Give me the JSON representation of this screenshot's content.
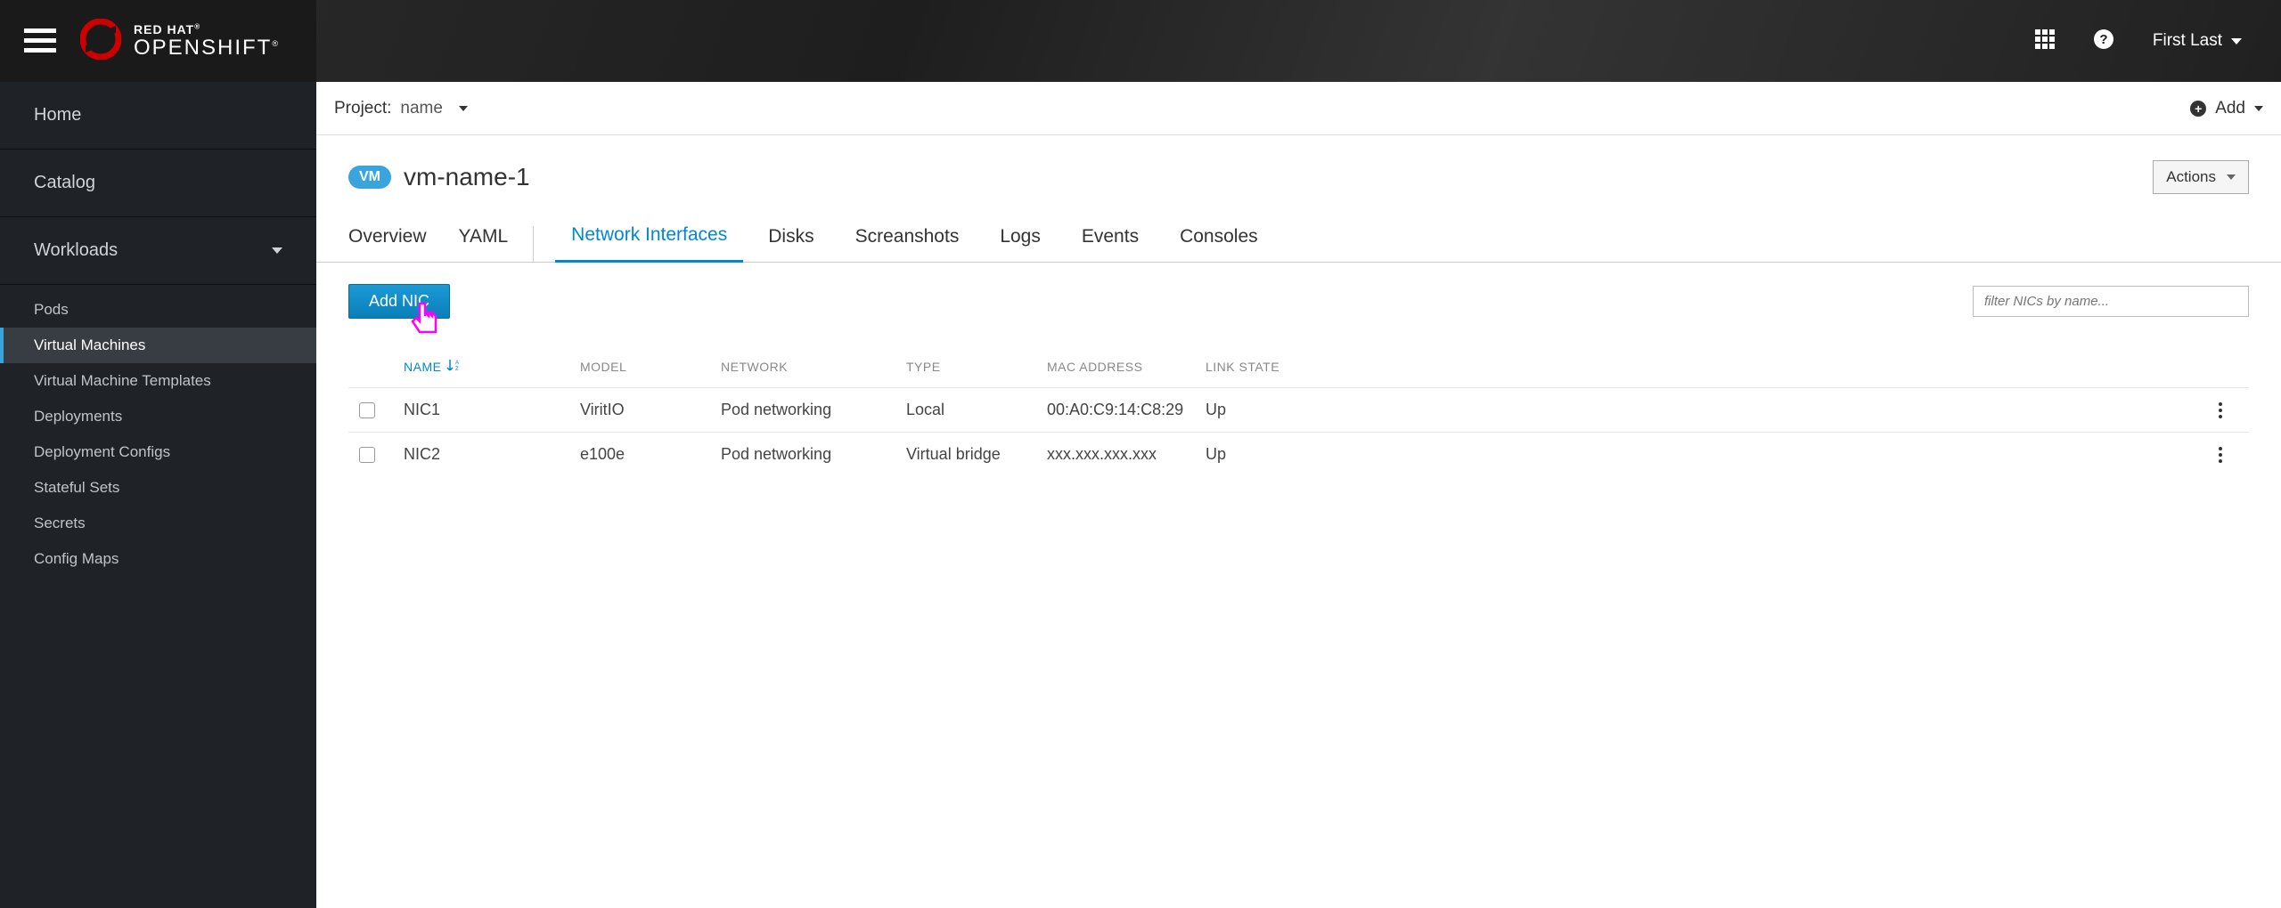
{
  "brand": {
    "line1": "RED HAT",
    "line2": "OPENSHIFT"
  },
  "user_name": "First Last",
  "sidebar": {
    "home": "Home",
    "catalog": "Catalog",
    "workloads": "Workloads",
    "subs": [
      "Pods",
      "Virtual Machines",
      "Virtual Machine Templates",
      "Deployments",
      "Deployment Configs",
      "Stateful Sets",
      "Secrets",
      "Config Maps"
    ]
  },
  "project": {
    "label": "Project:",
    "name": "name",
    "add": "Add"
  },
  "page": {
    "badge": "VM",
    "title": "vm-name-1",
    "actions": "Actions"
  },
  "tabs": [
    "Overview",
    "YAML",
    "Network Interfaces",
    "Disks",
    "Screanshots",
    "Logs",
    "Events",
    "Consoles"
  ],
  "toolbar": {
    "add_nic": "Add NIC",
    "filter_placeholder": "filter NICs by name..."
  },
  "columns": {
    "name": "NAME",
    "model": "MODEL",
    "network": "NETWORK",
    "type": "TYPE",
    "mac": "MAC ADDRESS",
    "link": "LINK STATE"
  },
  "rows": [
    {
      "name": "NIC1",
      "model": "ViritIO",
      "network": "Pod networking",
      "type": "Local",
      "mac": "00:A0:C9:14:C8:29",
      "link": "Up"
    },
    {
      "name": "NIC2",
      "model": "e100e",
      "network": "Pod networking",
      "type": "Virtual bridge",
      "mac": "xxx.xxx.xxx.xxx",
      "link": "Up"
    }
  ]
}
